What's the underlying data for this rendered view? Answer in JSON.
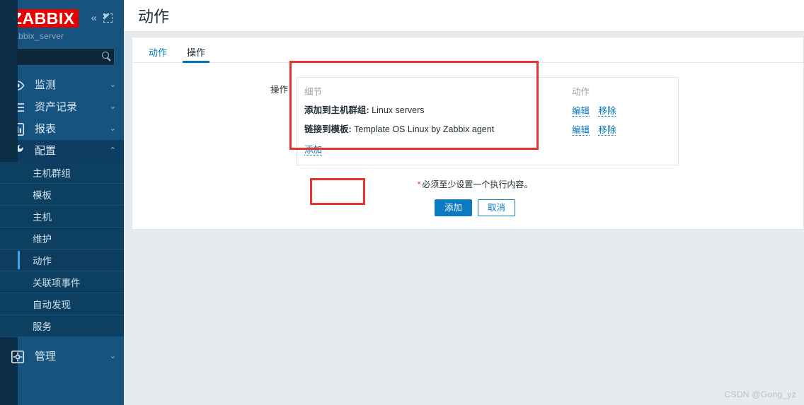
{
  "sidebar": {
    "logo_text": "ZABBIX",
    "server_name": "zabbix_server",
    "collapse_icon": "chevrons-left-icon",
    "hide_icon": "hide-sidebar-icon",
    "search": {
      "value": "",
      "placeholder": ""
    },
    "nav": [
      {
        "label": "监测",
        "icon": "eye-icon",
        "chevron": "⌄",
        "active": false
      },
      {
        "label": "资产记录",
        "icon": "list-icon",
        "chevron": "⌄",
        "active": false
      },
      {
        "label": "报表",
        "icon": "chart-icon",
        "chevron": "⌄",
        "active": false
      },
      {
        "label": "配置",
        "icon": "wrench-icon",
        "chevron": "⌃",
        "active": true
      },
      {
        "label": "管理",
        "icon": "gear-icon",
        "chevron": "⌄",
        "active": false
      }
    ],
    "submenu": [
      {
        "label": "主机群组",
        "active": false
      },
      {
        "label": "模板",
        "active": false
      },
      {
        "label": "主机",
        "active": false
      },
      {
        "label": "维护",
        "active": false
      },
      {
        "label": "动作",
        "active": true
      },
      {
        "label": "关联项事件",
        "active": false
      },
      {
        "label": "自动发现",
        "active": false
      },
      {
        "label": "服务",
        "active": false
      }
    ]
  },
  "header": {
    "title": "动作"
  },
  "tabs": [
    {
      "label": "动作",
      "active": false
    },
    {
      "label": "操作",
      "active": true
    }
  ],
  "form": {
    "operations_label": "操作",
    "columns": {
      "detail": "细节",
      "action": "动作"
    },
    "rows": [
      {
        "label": "添加到主机群组:",
        "value": " Linux servers",
        "edit": "编辑",
        "remove": "移除"
      },
      {
        "label": "链接到模板:",
        "value": " Template OS Linux by Zabbix agent",
        "edit": "编辑",
        "remove": "移除"
      }
    ],
    "add_link": "添加",
    "hint_star": "*",
    "hint_text": "必须至少设置一个执行内容。",
    "buttons": {
      "submit": "添加",
      "cancel": "取消"
    }
  },
  "watermark": "CSDN @Gong_yz",
  "colors": {
    "brand_red": "#e60000",
    "sidebar_bg": "#16537f",
    "accent_blue": "#0275b8",
    "button_blue": "#0b7ac0",
    "annotation_red": "#e8332f",
    "page_bg": "#e8ebee"
  }
}
